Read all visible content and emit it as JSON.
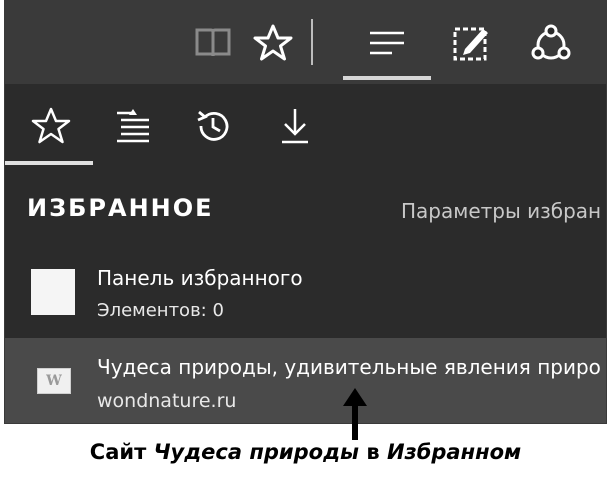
{
  "toolbar": {
    "icons": [
      "reading-view-icon",
      "favorite-star-icon",
      "hub-icon",
      "web-note-icon",
      "share-icon"
    ]
  },
  "hub": {
    "tabs": [
      "favorites-tab",
      "reading-list-tab",
      "history-tab",
      "downloads-tab"
    ]
  },
  "panel": {
    "title": "ИЗБРАННОЕ",
    "settings_label": "Параметры избран"
  },
  "favorites": {
    "folder": {
      "name": "Панель избранного",
      "count": "Элементов: 0"
    },
    "site": {
      "title": "Чудеса природы, удивительные явления приро",
      "url": "wondnature.ru",
      "favicon_letter": "W"
    }
  },
  "caption": {
    "prefix": "Сайт ",
    "emph1": "Чудеса природы",
    "middle": " в ",
    "emph2": "Избранном"
  },
  "colors": {
    "panel_bg": "#2b2b2b",
    "toolbar_bg": "#3a3a3a",
    "highlight": "#4a4a4a"
  }
}
